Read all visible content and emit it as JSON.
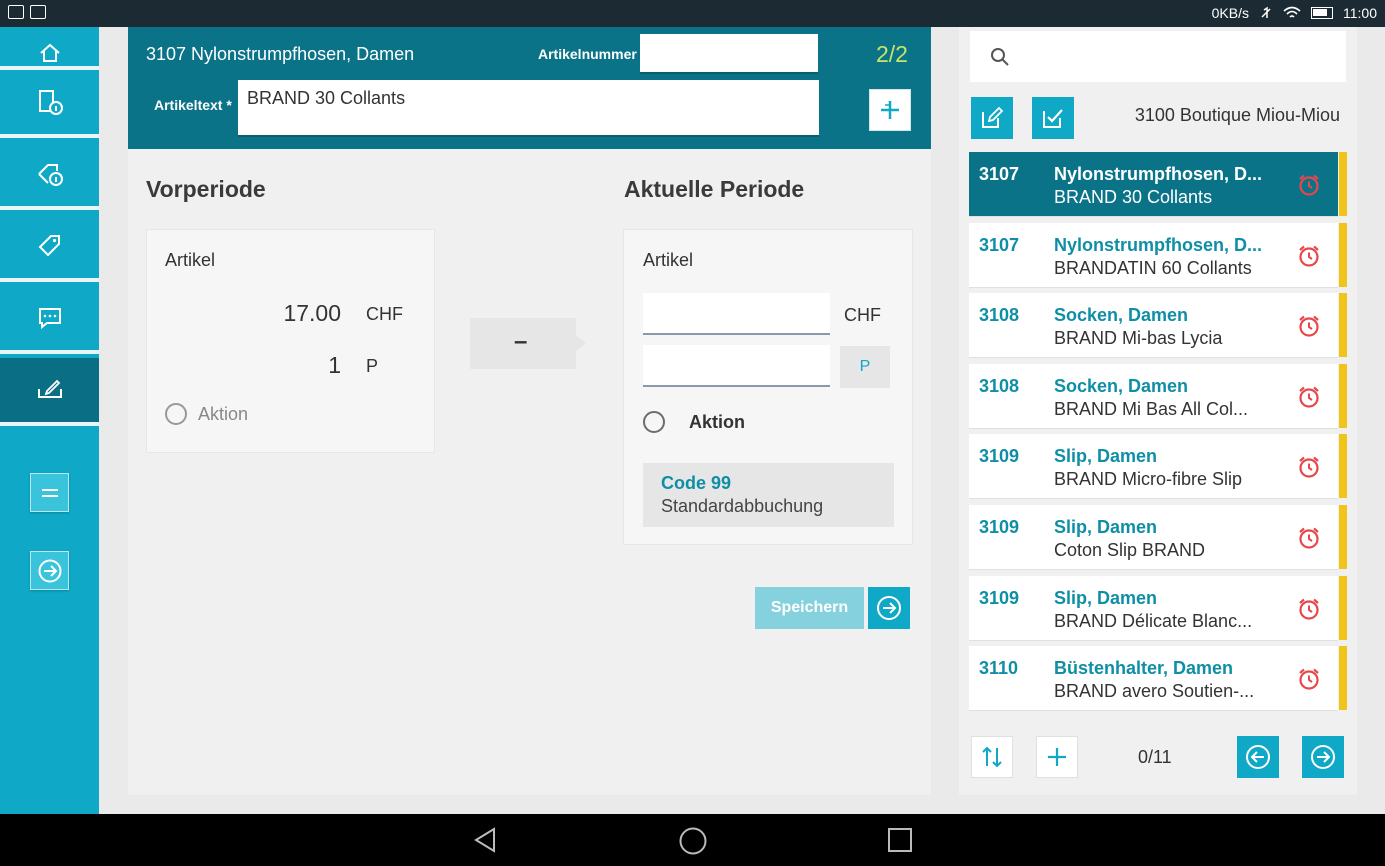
{
  "status_bar": {
    "net_speed": "0KB/s",
    "time": "11:00"
  },
  "sidebar": {
    "items": [
      {
        "icon": "home-icon"
      },
      {
        "icon": "article-info-icon"
      },
      {
        "icon": "tag-info-icon"
      },
      {
        "icon": "tag-icon"
      },
      {
        "icon": "chat-icon"
      },
      {
        "icon": "edit-signature-icon"
      }
    ],
    "buttons": [
      {
        "icon": "equals-icon"
      },
      {
        "icon": "arrow-right-circle-icon"
      }
    ]
  },
  "header": {
    "title": "3107 Nylonstrumpfhosen, Damen",
    "artikelnummer_label": "Artikelnummer",
    "artikelnummer_value": "",
    "counter": "2/2",
    "artikeltext_label": "Artikeltext *",
    "artikeltext_value": "BRAND 30 Collants"
  },
  "vorperiode": {
    "title": "Vorperiode",
    "card_title": "Artikel",
    "price": "17.00",
    "currency": "CHF",
    "qty": "1",
    "unit": "P",
    "aktion_label": "Aktion"
  },
  "copy_button": {
    "label": "–"
  },
  "aktuelle_periode": {
    "title": "Aktuelle Periode",
    "card_title": "Artikel",
    "currency": "CHF",
    "unit_button": "P",
    "aktion_label": "Aktion",
    "code_title": "Code 99",
    "code_desc": "Standardabbuchung"
  },
  "actions": {
    "save_label": "Speichern"
  },
  "right_panel": {
    "search_placeholder": "",
    "store_name": "3100 Boutique Miou-Miou",
    "items": [
      {
        "num": "3107",
        "line1": "Nylonstrumpfhosen, D...",
        "line2": "BRAND 30 Collants",
        "selected": true
      },
      {
        "num": "3107",
        "line1": "Nylonstrumpfhosen, D...",
        "line2": "BRANDATIN 60 Collants",
        "selected": false
      },
      {
        "num": "3108",
        "line1": "Socken, Damen",
        "line2": "BRAND Mi-bas Lycia",
        "selected": false
      },
      {
        "num": "3108",
        "line1": "Socken, Damen",
        "line2": "BRAND Mi Bas All Col...",
        "selected": false
      },
      {
        "num": "3109",
        "line1": "Slip, Damen",
        "line2": "BRAND Micro-fibre Slip",
        "selected": false
      },
      {
        "num": "3109",
        "line1": "Slip, Damen",
        "line2": "Coton Slip BRAND",
        "selected": false
      },
      {
        "num": "3109",
        "line1": "Slip, Damen",
        "line2": "BRAND Délicate Blanc...",
        "selected": false
      },
      {
        "num": "3110",
        "line1": "Büstenhalter, Damen",
        "line2": "BRAND avero Soutien-...",
        "selected": false
      }
    ],
    "pagination": "0/11"
  },
  "colors": {
    "primary": "#0fa8c6",
    "primary_dark": "#0a7388",
    "accent_yellow": "#f0c419",
    "alarm_red": "#e8474a"
  }
}
